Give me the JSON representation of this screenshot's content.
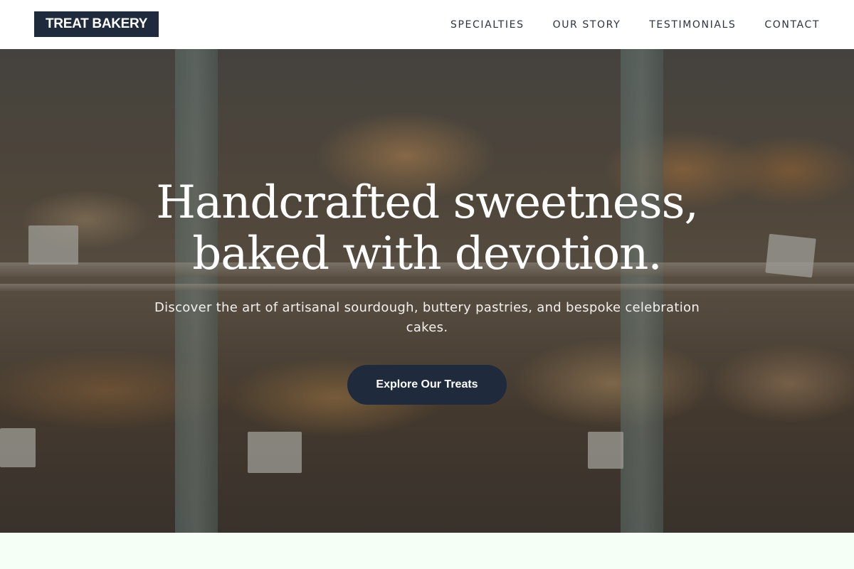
{
  "header": {
    "logo": "TREAT BAKERY",
    "nav": [
      {
        "label": "SPECIALTIES"
      },
      {
        "label": "OUR STORY"
      },
      {
        "label": "TESTIMONIALS"
      },
      {
        "label": "CONTACT"
      }
    ]
  },
  "hero": {
    "title_line1": "Handcrafted sweetness,",
    "title_line2": "baked with devotion.",
    "subtitle": "Discover the art of artisanal sourdough, buttery pastries, and bespoke celebration cakes.",
    "cta_label": "Explore Our Treats",
    "background_image": "bakery display case with croissants and tarts"
  },
  "colors": {
    "brand_navy": "#1f2a3d",
    "header_bg": "#ffffff",
    "nav_text": "#2c3340",
    "page_bg": "#f6fff6"
  }
}
